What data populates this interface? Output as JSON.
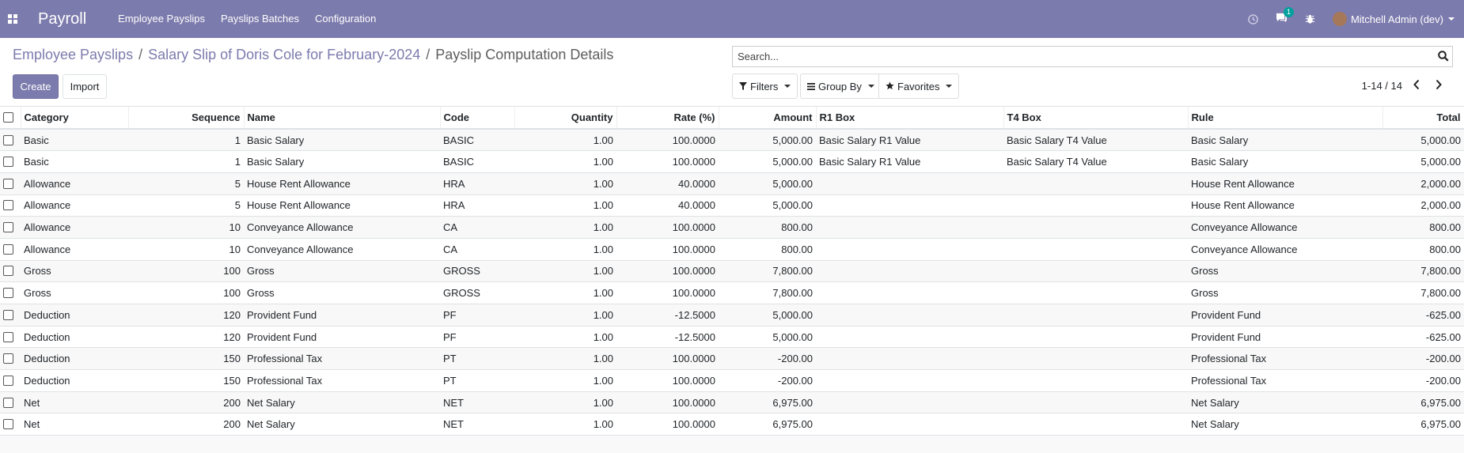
{
  "navbar": {
    "apps_icon": "apps-grid-icon",
    "brand": "Payroll",
    "menu": [
      "Employee Payslips",
      "Payslips Batches",
      "Configuration"
    ],
    "activity_icon": "clock-icon",
    "messages_icon": "chat-icon",
    "messages_count": "1",
    "debug_icon": "bug-icon",
    "user": "Mitchell Admin (dev)"
  },
  "breadcrumb": {
    "items": [
      "Employee Payslips",
      "Salary Slip of Doris Cole for February-2024"
    ],
    "separator": "/",
    "current": "Payslip Computation Details"
  },
  "buttons": {
    "create": "Create",
    "import": "Import"
  },
  "search": {
    "placeholder": "Search..."
  },
  "filters": {
    "filters": "Filters",
    "group_by": "Group By",
    "favorites": "Favorites"
  },
  "pager": {
    "range": "1-14 / 14"
  },
  "table": {
    "columns": [
      "Category",
      "Sequence",
      "Name",
      "Code",
      "Quantity",
      "Rate (%)",
      "Amount",
      "R1 Box",
      "T4 Box",
      "Rule",
      "Total"
    ],
    "rows": [
      [
        "Basic",
        "1",
        "Basic Salary",
        "BASIC",
        "1.00",
        "100.0000",
        "5,000.00",
        "Basic Salary R1 Value",
        "Basic Salary T4 Value",
        "Basic Salary",
        "5,000.00"
      ],
      [
        "Basic",
        "1",
        "Basic Salary",
        "BASIC",
        "1.00",
        "100.0000",
        "5,000.00",
        "Basic Salary R1 Value",
        "Basic Salary T4 Value",
        "Basic Salary",
        "5,000.00"
      ],
      [
        "Allowance",
        "5",
        "House Rent Allowance",
        "HRA",
        "1.00",
        "40.0000",
        "5,000.00",
        "",
        "",
        "House Rent Allowance",
        "2,000.00"
      ],
      [
        "Allowance",
        "5",
        "House Rent Allowance",
        "HRA",
        "1.00",
        "40.0000",
        "5,000.00",
        "",
        "",
        "House Rent Allowance",
        "2,000.00"
      ],
      [
        "Allowance",
        "10",
        "Conveyance Allowance",
        "CA",
        "1.00",
        "100.0000",
        "800.00",
        "",
        "",
        "Conveyance Allowance",
        "800.00"
      ],
      [
        "Allowance",
        "10",
        "Conveyance Allowance",
        "CA",
        "1.00",
        "100.0000",
        "800.00",
        "",
        "",
        "Conveyance Allowance",
        "800.00"
      ],
      [
        "Gross",
        "100",
        "Gross",
        "GROSS",
        "1.00",
        "100.0000",
        "7,800.00",
        "",
        "",
        "Gross",
        "7,800.00"
      ],
      [
        "Gross",
        "100",
        "Gross",
        "GROSS",
        "1.00",
        "100.0000",
        "7,800.00",
        "",
        "",
        "Gross",
        "7,800.00"
      ],
      [
        "Deduction",
        "120",
        "Provident Fund",
        "PF",
        "1.00",
        "-12.5000",
        "5,000.00",
        "",
        "",
        "Provident Fund",
        "-625.00"
      ],
      [
        "Deduction",
        "120",
        "Provident Fund",
        "PF",
        "1.00",
        "-12.5000",
        "5,000.00",
        "",
        "",
        "Provident Fund",
        "-625.00"
      ],
      [
        "Deduction",
        "150",
        "Professional Tax",
        "PT",
        "1.00",
        "100.0000",
        "-200.00",
        "",
        "",
        "Professional Tax",
        "-200.00"
      ],
      [
        "Deduction",
        "150",
        "Professional Tax",
        "PT",
        "1.00",
        "100.0000",
        "-200.00",
        "",
        "",
        "Professional Tax",
        "-200.00"
      ],
      [
        "Net",
        "200",
        "Net Salary",
        "NET",
        "1.00",
        "100.0000",
        "6,975.00",
        "",
        "",
        "Net Salary",
        "6,975.00"
      ],
      [
        "Net",
        "200",
        "Net Salary",
        "NET",
        "1.00",
        "100.0000",
        "6,975.00",
        "",
        "",
        "Net Salary",
        "6,975.00"
      ]
    ]
  }
}
